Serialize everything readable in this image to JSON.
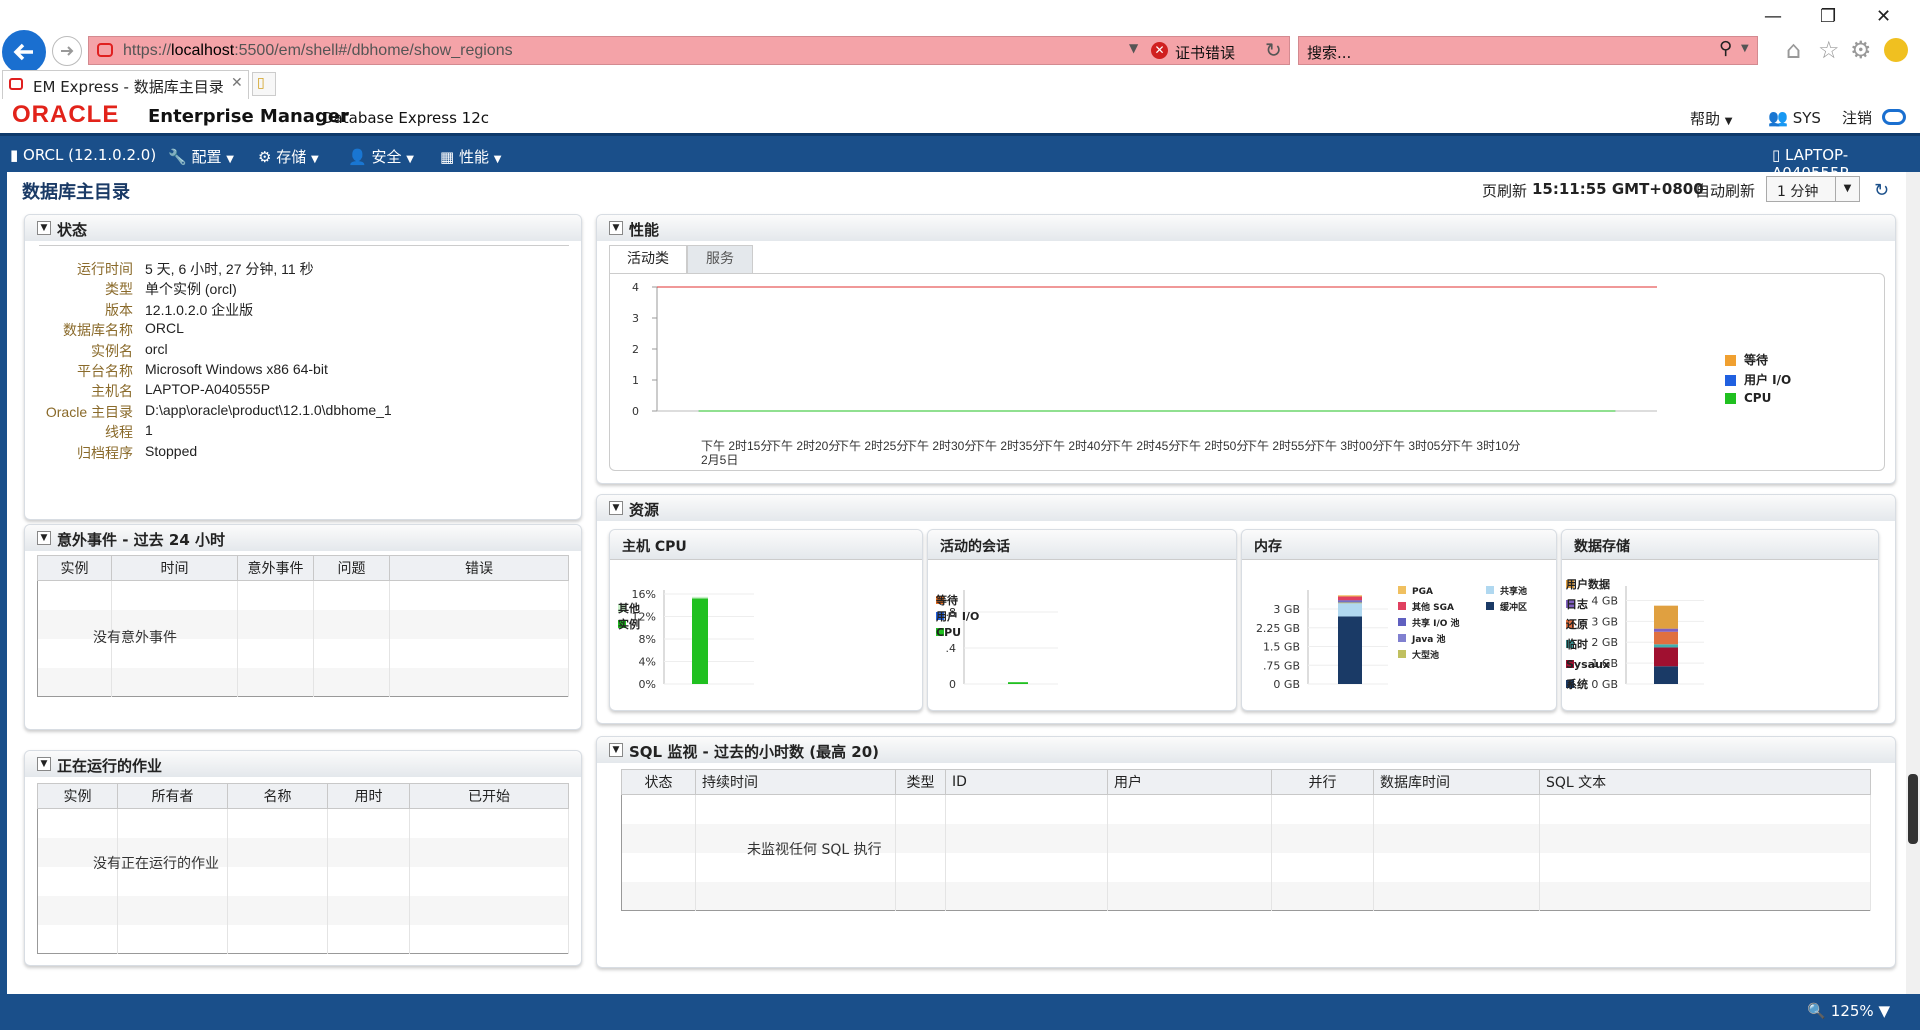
{
  "browser": {
    "url_prefix": "https://",
    "url_host": "localhost",
    "url_rest": ":5500/em/shell#/dbhome/show_regions",
    "cert_error": "证书错误",
    "search_placeholder": "搜索...",
    "tab_title": "EM Express - 数据库主目录",
    "zoom": "125%"
  },
  "header": {
    "logo": "ORACLE",
    "product": "Enterprise Manager",
    "edition": "Database Express 12c",
    "help": "帮助",
    "user": "SYS",
    "logout": "注销"
  },
  "nav": {
    "db": "ORCL (12.1.0.2.0)",
    "config": "配置",
    "storage": "存储",
    "security": "安全",
    "performance": "性能",
    "host": "LAPTOP-A040555P"
  },
  "page": {
    "title": "数据库主目录",
    "refresh_label": "页刷新",
    "refresh_time": "15:11:55 GMT+0800",
    "auto_label": "自动刷新",
    "auto_value": "1 分钟"
  },
  "status": {
    "title": "状态",
    "rows": [
      {
        "k": "运行时间",
        "v": "5 天, 6 小时, 27 分钟, 11 秒"
      },
      {
        "k": "类型",
        "v": "单个实例 (orcl)"
      },
      {
        "k": "版本",
        "v": "12.1.0.2.0 企业版"
      },
      {
        "k": "数据库名称",
        "v": "ORCL"
      },
      {
        "k": "实例名",
        "v": "orcl"
      },
      {
        "k": "平台名称",
        "v": "Microsoft Windows x86 64-bit"
      },
      {
        "k": "主机名",
        "v": "LAPTOP-A040555P"
      },
      {
        "k": "Oracle 主目录",
        "v": "D:\\app\\oracle\\product\\12.1.0\\dbhome_1"
      },
      {
        "k": "线程",
        "v": "1"
      },
      {
        "k": "归档程序",
        "v": "Stopped"
      }
    ]
  },
  "incidents": {
    "title": "意外事件 - 过去 24 小时",
    "columns": [
      "实例",
      "时间",
      "意外事件",
      "问题",
      "错误"
    ],
    "empty": "没有意外事件"
  },
  "jobs": {
    "title": "正在运行的作业",
    "columns": [
      "实例",
      "所有者",
      "名称",
      "用时",
      "已开始"
    ],
    "empty": "没有正在运行的作业"
  },
  "perf": {
    "title": "性能",
    "tabs": [
      "活动类",
      "服务"
    ],
    "legend": [
      {
        "name": "等待",
        "color": "#f0a030"
      },
      {
        "name": "用户 I/O",
        "color": "#2060e0"
      },
      {
        "name": "CPU",
        "color": "#20c020"
      }
    ]
  },
  "chart_data": [
    {
      "type": "line",
      "title": "活动类",
      "x": [
        "下午 2时15分",
        "下午 2时20分",
        "下午 2时25分",
        "下午 2时30分",
        "下午 2时35分",
        "下午 2时40分",
        "下午 2时45分",
        "下午 2时50分",
        "下午 2时55分",
        "下午 3时00分",
        "下午 3时05分",
        "下午 3时10分"
      ],
      "x_sub": "2月5日",
      "yticks": [
        "0",
        "1",
        "2",
        "3",
        "4"
      ],
      "ylim": [
        0,
        4
      ],
      "reference_line": 4,
      "series": [
        {
          "name": "等待",
          "values": [
            0,
            0,
            0,
            0,
            0,
            0,
            0,
            0,
            0,
            0,
            0,
            0
          ]
        },
        {
          "name": "用户 I/O",
          "values": [
            0,
            0,
            0,
            0,
            0,
            0,
            0,
            0,
            0,
            0,
            0,
            0
          ]
        },
        {
          "name": "CPU",
          "values": [
            0,
            0,
            0,
            0,
            0,
            0,
            0,
            0,
            0,
            0,
            0,
            0
          ]
        }
      ]
    },
    {
      "type": "bar",
      "title": "主机 CPU",
      "yticks": [
        "0%",
        "4%",
        "8%",
        "12%",
        "16%"
      ],
      "ylim": [
        0,
        16
      ],
      "series": [
        {
          "name": "其他",
          "values": [
            0.3
          ]
        },
        {
          "name": "实例",
          "values": [
            15.2
          ]
        }
      ]
    },
    {
      "type": "bar",
      "title": "活动的会话",
      "yticks": [
        "0",
        ".4",
        ".8"
      ],
      "ylim": [
        0,
        1
      ],
      "series": [
        {
          "name": "等待",
          "values": [
            0
          ]
        },
        {
          "name": "用户 I/O",
          "values": [
            0
          ]
        },
        {
          "name": "CPU",
          "values": [
            0.02
          ]
        }
      ]
    },
    {
      "type": "bar",
      "title": "内存",
      "yticks": [
        "0 GB",
        ".75 GB",
        "1.5 GB",
        "2.25 GB",
        "3 GB"
      ],
      "ylim": [
        0,
        3.6
      ],
      "series": [
        {
          "name": "PGA",
          "values": [
            0.05
          ]
        },
        {
          "name": "其他 SGA",
          "values": [
            0.15
          ]
        },
        {
          "name": "共享 I/O 池",
          "values": [
            0.05
          ]
        },
        {
          "name": "Java 池",
          "values": [
            0.03
          ]
        },
        {
          "name": "大型池",
          "values": [
            0.02
          ]
        },
        {
          "name": "共享池",
          "values": [
            0.55
          ]
        },
        {
          "name": "缓冲区",
          "values": [
            2.7
          ]
        }
      ]
    },
    {
      "type": "bar",
      "title": "数据存储",
      "yticks": [
        "0 GB",
        "1 GB",
        "2 GB",
        "3 GB",
        "4 GB"
      ],
      "ylim": [
        0,
        4.5
      ],
      "series": [
        {
          "name": "用户数据",
          "values": [
            1.1
          ]
        },
        {
          "name": "日志",
          "values": [
            0.15
          ]
        },
        {
          "name": "还原",
          "values": [
            0.6
          ]
        },
        {
          "name": "临时",
          "values": [
            0.15
          ]
        },
        {
          "name": "Sysaux",
          "values": [
            0.9
          ]
        },
        {
          "name": "系统",
          "values": [
            0.85
          ]
        }
      ]
    }
  ],
  "resources": {
    "title": "资源",
    "host_cpu": {
      "title": "主机 CPU",
      "legend": [
        {
          "name": "其他",
          "color": "#c8f0c8"
        },
        {
          "name": "实例",
          "color": "#20c020"
        }
      ]
    },
    "sessions": {
      "title": "活动的会话",
      "legend": [
        {
          "name": "等待",
          "color": "#f07020"
        },
        {
          "name": "用户 I/O",
          "color": "#2060e0"
        },
        {
          "name": "CPU",
          "color": "#20c020"
        }
      ]
    },
    "memory": {
      "title": "内存",
      "legend": [
        {
          "name": "PGA",
          "color": "#f0c060"
        },
        {
          "name": "其他 SGA",
          "color": "#e04060"
        },
        {
          "name": "共享 I/O 池",
          "color": "#6060c0"
        },
        {
          "name": "Java 池",
          "color": "#8080d0"
        },
        {
          "name": "大型池",
          "color": "#c0c060"
        },
        {
          "name": "共享池",
          "color": "#b0d8f0"
        },
        {
          "name": "缓冲区",
          "color": "#1a3a66"
        }
      ]
    },
    "storage": {
      "title": "数据存储",
      "legend": [
        {
          "name": "用户数据",
          "color": "#e0a040"
        },
        {
          "name": "日志",
          "color": "#8060c0"
        },
        {
          "name": "还原",
          "color": "#e07040"
        },
        {
          "name": "临时",
          "color": "#40b0b0"
        },
        {
          "name": "Sysaux",
          "color": "#a01030"
        },
        {
          "name": "系统",
          "color": "#1a3a66"
        }
      ]
    }
  },
  "sql": {
    "title": "SQL 监视 - 过去的小时数 (最高 20)",
    "columns": [
      "状态",
      "持续时间",
      "类型",
      "ID",
      "用户",
      "并行",
      "数据库时间",
      "SQL 文本"
    ],
    "empty": "未监视任何 SQL 执行"
  }
}
